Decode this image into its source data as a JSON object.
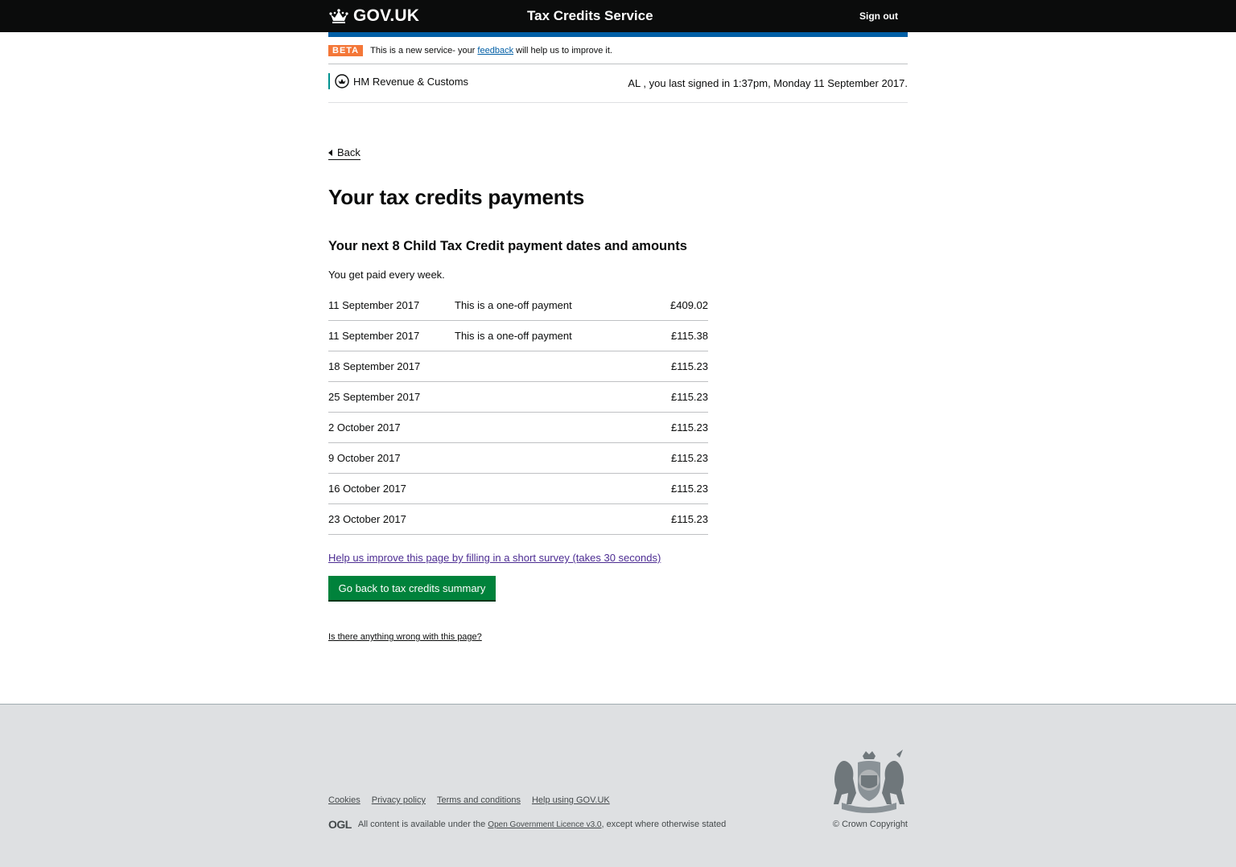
{
  "header": {
    "logo_text": "GOV.UK",
    "service_name": "Tax Credits Service",
    "sign_out": "Sign out"
  },
  "phase_banner": {
    "tag": "BETA",
    "text_before": "This is a new service- your",
    "link": "feedback",
    "text_after": "will help us to improve it."
  },
  "account_bar": {
    "department": "HM Revenue & Customs",
    "last_signed_in": "AL , you last signed in 1:37pm, Monday 11 September 2017."
  },
  "back_link": "Back",
  "main": {
    "title": "Your tax credits payments",
    "subtitle": "Your next 8 Child Tax Credit payment dates and amounts",
    "frequency": "You get paid every week.",
    "payments": [
      {
        "date": "11 September 2017",
        "note": "This is a one-off payment",
        "amount": "£409.02"
      },
      {
        "date": "11 September 2017",
        "note": "This is a one-off payment",
        "amount": "£115.38"
      },
      {
        "date": "18 September 2017",
        "note": "",
        "amount": "£115.23"
      },
      {
        "date": "25 September 2017",
        "note": "",
        "amount": "£115.23"
      },
      {
        "date": "2 October 2017",
        "note": "",
        "amount": "£115.23"
      },
      {
        "date": "9 October 2017",
        "note": "",
        "amount": "£115.23"
      },
      {
        "date": "16 October 2017",
        "note": "",
        "amount": "£115.23"
      },
      {
        "date": "23 October 2017",
        "note": "",
        "amount": "£115.23"
      }
    ],
    "survey_link": "Help us improve this page by filling in a short survey (takes 30 seconds)",
    "back_button": "Go back to tax credits summary",
    "report_link": "Is there anything wrong with this page?"
  },
  "footer": {
    "links": [
      "Cookies",
      "Privacy policy",
      "Terms and conditions",
      "Help using GOV.UK"
    ],
    "ogl": "OGL",
    "licence_before": "All content is available under the",
    "licence_link": "Open Government Licence v3.0",
    "licence_after": ", except where otherwise stated",
    "copyright": "© Crown Copyright"
  },
  "colors": {
    "header_bg": "#0b0c0c",
    "blue_bar": "#005ea5",
    "beta_tag": "#f47738",
    "button_green": "#00823b",
    "survey_link": "#4c2c92",
    "footer_bg": "#dee0e2"
  },
  "icons": {
    "logo": "crown-icon",
    "department": "hmrc-crest-icon",
    "back": "caret-left-icon",
    "footer_crest": "royal-coat-of-arms"
  }
}
